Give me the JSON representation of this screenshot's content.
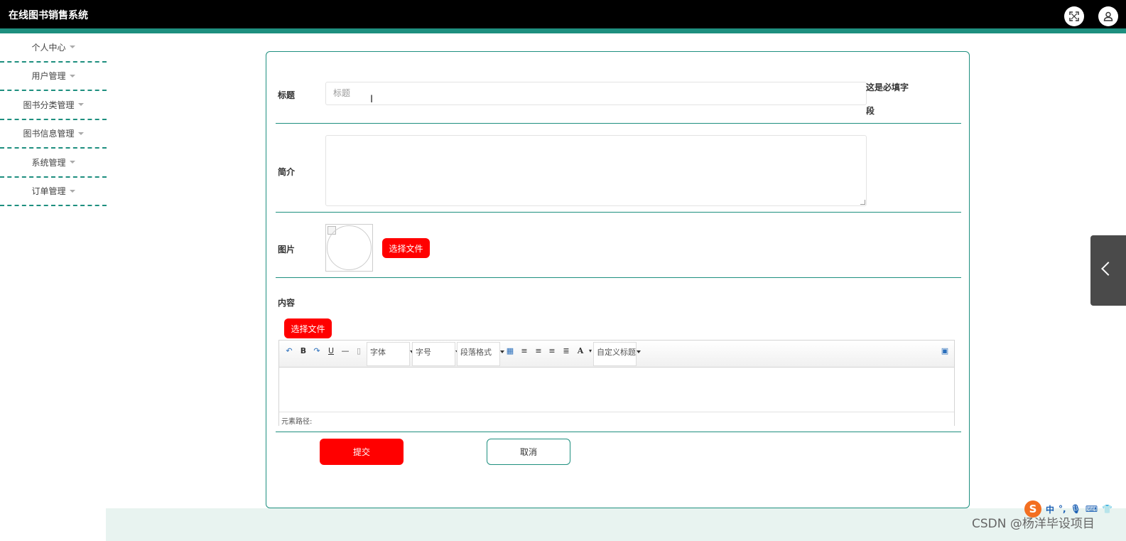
{
  "app": {
    "title": "在线图书销售系统"
  },
  "header_icons": [
    "fullscreen-icon",
    "user-icon"
  ],
  "sidebar": {
    "items": [
      {
        "label": "个人中心"
      },
      {
        "label": "用户管理"
      },
      {
        "label": "图书分类管理"
      },
      {
        "label": "图书信息管理"
      },
      {
        "label": "系统管理"
      },
      {
        "label": "订单管理"
      }
    ]
  },
  "form": {
    "title_label": "标题",
    "title_placeholder": "标题",
    "required_note": "这是必填字段",
    "intro_label": "简介",
    "image_label": "图片",
    "image_button": "选择文件",
    "content_label": "内容",
    "content_button": "选择文件",
    "submit": "提交",
    "cancel": "取消"
  },
  "editor": {
    "font_select": "字体",
    "size_select": "字号",
    "paragraph_select": "段落格式",
    "custom_heading_select": "自定义标题",
    "path_label": "元素路径:"
  },
  "colors": {
    "accent": "#1e8f7f",
    "danger": "#ff0000",
    "topbar": "#000000"
  },
  "watermark": "CSDN @杨洋毕设项目",
  "ime": {
    "mode": "中"
  }
}
